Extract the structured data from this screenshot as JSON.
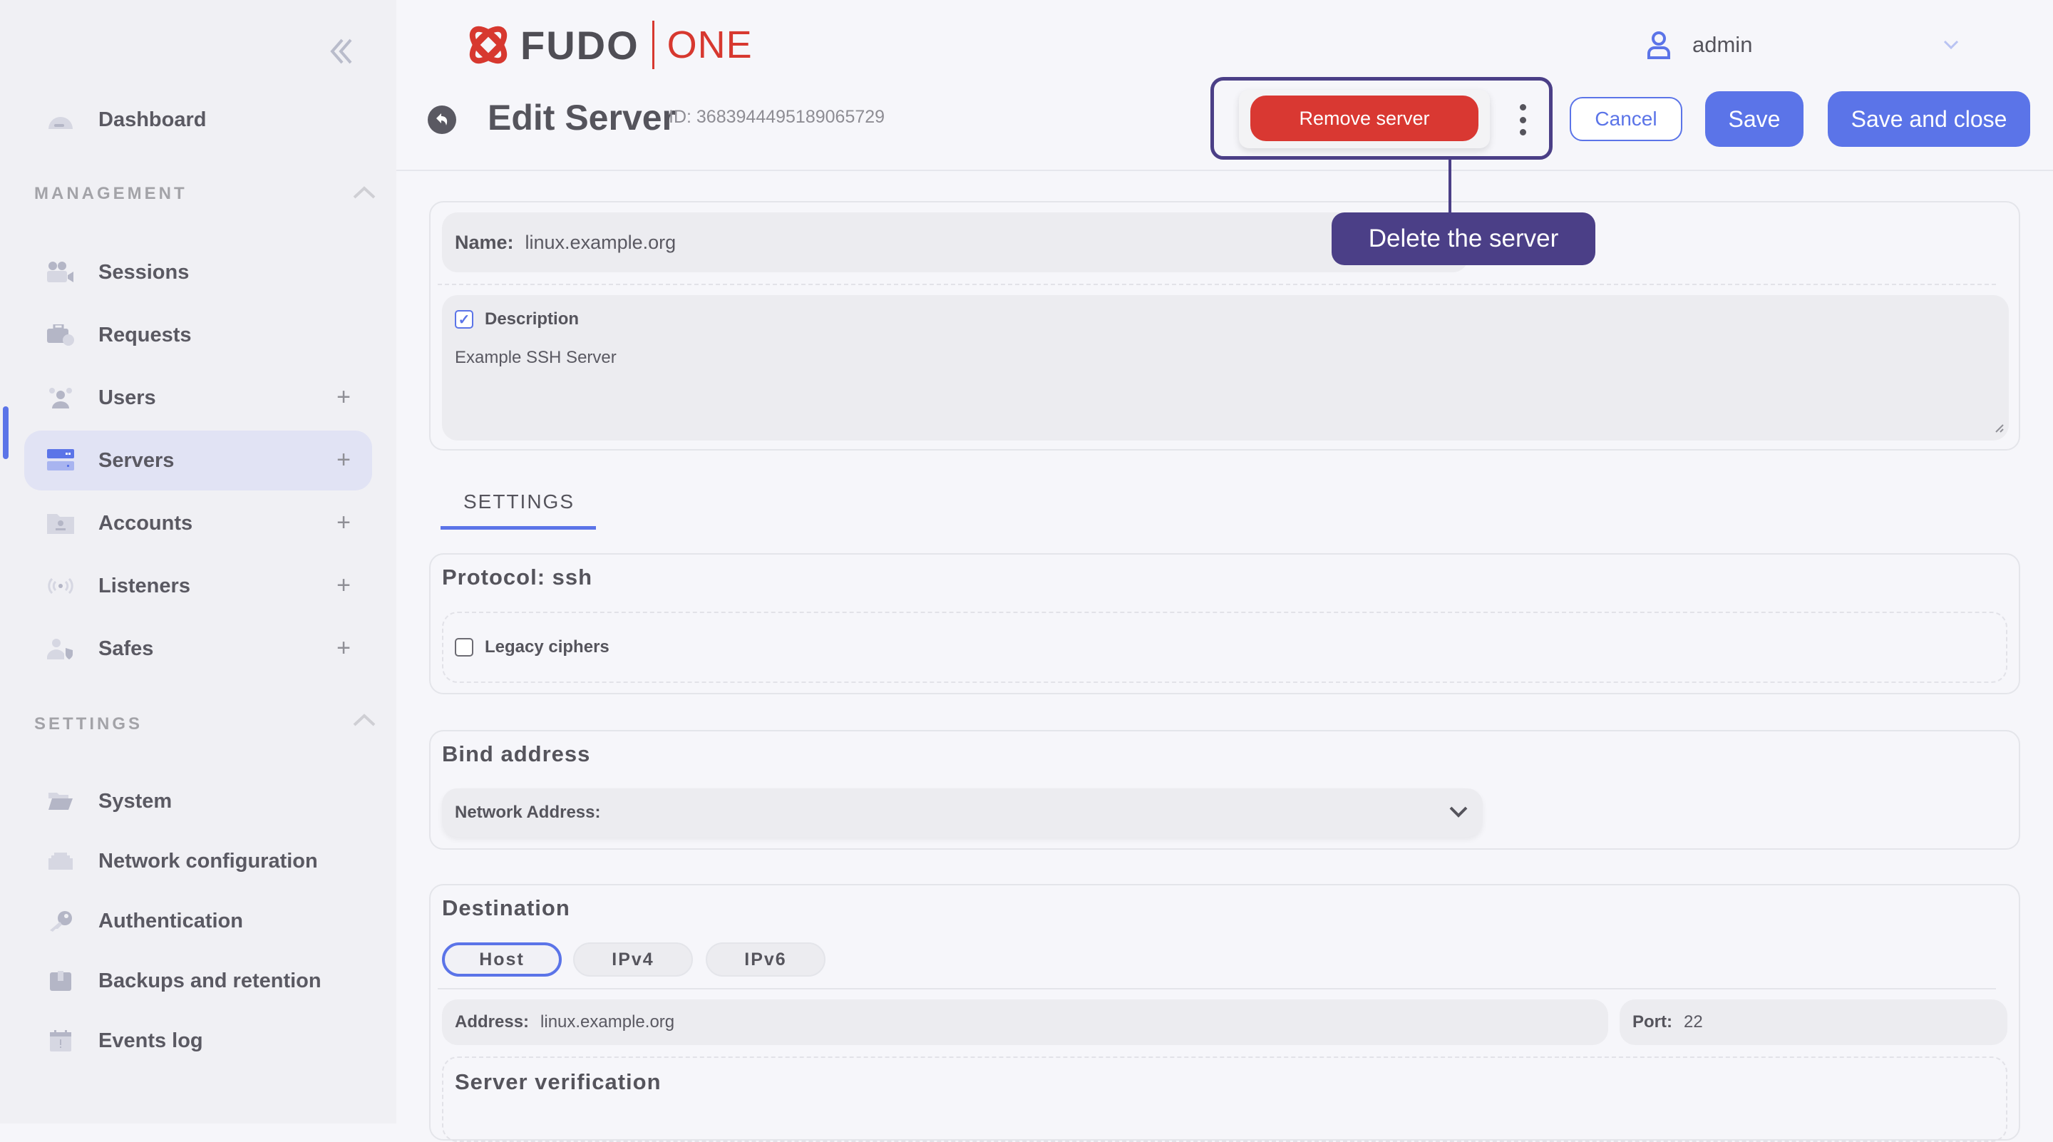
{
  "sidebar": {
    "dashboard": "Dashboard",
    "management_title": "MANAGEMENT",
    "management": [
      {
        "label": "Sessions",
        "icon": "video-camera-icon",
        "plus": false
      },
      {
        "label": "Requests",
        "icon": "briefcase-clock-icon",
        "plus": false
      },
      {
        "label": "Users",
        "icon": "users-icon",
        "plus": true
      },
      {
        "label": "Servers",
        "icon": "server-icon",
        "plus": true,
        "active": true
      },
      {
        "label": "Accounts",
        "icon": "folder-user-icon",
        "plus": true
      },
      {
        "label": "Listeners",
        "icon": "broadcast-icon",
        "plus": true
      },
      {
        "label": "Safes",
        "icon": "user-shield-icon",
        "plus": true
      }
    ],
    "settings_title": "SETTINGS",
    "settings": [
      {
        "label": "System",
        "icon": "folder-open-icon"
      },
      {
        "label": "Network configuration",
        "icon": "ethernet-icon"
      },
      {
        "label": "Authentication",
        "icon": "key-icon"
      },
      {
        "label": "Backups and retention",
        "icon": "box-icon"
      },
      {
        "label": "Events log",
        "icon": "calendar-alert-icon"
      }
    ],
    "plus_glyph": "+"
  },
  "header": {
    "logo_brand": "FUDO",
    "logo_product": "ONE",
    "user": "admin",
    "title": "Edit Server",
    "id_label": "ID: 3683944495189065729",
    "remove_label": "Remove server",
    "cancel_label": "Cancel",
    "save_label": "Save",
    "save_close_label": "Save and close",
    "callout": "Delete the server"
  },
  "colors": {
    "accent": "#5b74e8",
    "danger": "#d93832",
    "callout": "#4b3f87",
    "brand_red": "#d7382f"
  },
  "form": {
    "name_label": "Name:",
    "name_value": "linux.example.org",
    "description_label": "Description",
    "description_checked": true,
    "description_value": "Example SSH Server",
    "tab": "SETTINGS",
    "protocol_title": "Protocol: ssh",
    "legacy_label": "Legacy ciphers",
    "legacy_checked": false,
    "bind_title": "Bind address",
    "network_label": "Network Address:",
    "network_value": "",
    "destination_title": "Destination",
    "dest_options": [
      "Host",
      "IPv4",
      "IPv6"
    ],
    "dest_selected": "Host",
    "address_label": "Address:",
    "address_value": "linux.example.org",
    "port_label": "Port:",
    "port_value": "22",
    "verification_title": "Server verification"
  }
}
